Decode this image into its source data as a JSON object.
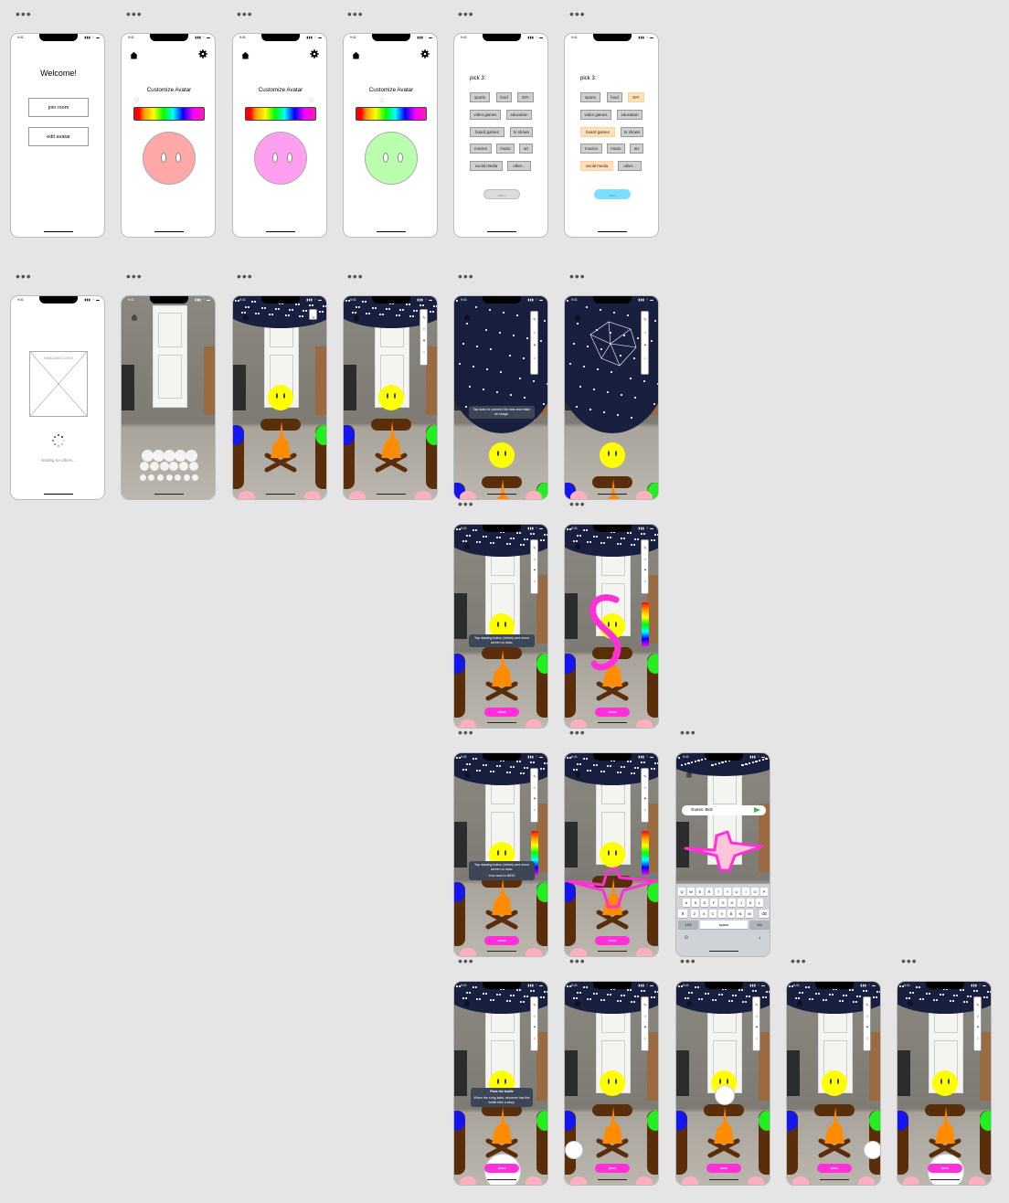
{
  "status": {
    "time": "9:41",
    "icons": "▮▮▮ ⌔ ▬"
  },
  "welcome": {
    "title": "Welcome!",
    "join": "join room",
    "edit": "edit avatar"
  },
  "customize": {
    "title": "Customize Avatar",
    "heart": "♡",
    "colors": [
      "#ffa8a8",
      "#ff9ff0",
      "#baffae"
    ]
  },
  "pick": {
    "title": "pick 3:",
    "chips": [
      "sports",
      "food",
      "DIY",
      "video games",
      "education",
      "board games",
      "tv shows",
      "movies",
      "music",
      "art",
      "social media",
      "other..."
    ],
    "start": "start",
    "selected_count": 3
  },
  "loading": {
    "logo": "KINDLING LOGO",
    "waiting": "Waiting for others..."
  },
  "tips": {
    "stars": "Tap stars to connect the dots and make an image.",
    "draw": "Tap drawing button (below) and move screen to draw.",
    "word": "Your word is BIRD",
    "pass_title": "Pass the bottle",
    "pass_body": "When the song lasts, whoever has the bottle tells a story."
  },
  "buttons": {
    "draw": "draw",
    "pass": "pass"
  },
  "guess": {
    "text": "Guess: Bird"
  },
  "keyboard": {
    "row1": [
      "Q",
      "W",
      "E",
      "R",
      "T",
      "Y",
      "U",
      "I",
      "O",
      "P"
    ],
    "row2": [
      "A",
      "S",
      "D",
      "F",
      "G",
      "H",
      "J",
      "K",
      "L"
    ],
    "row3": [
      "Z",
      "X",
      "C",
      "V",
      "B",
      "N",
      "M"
    ],
    "num": "123",
    "space": "space",
    "go": "Go"
  },
  "colors": {
    "sky": "#19203f",
    "fire": "#ff8c00",
    "log": "#5a2e0a",
    "pink": "#ff30d8",
    "yellow": "#ffff00",
    "blue": "#1515ee",
    "green": "#22ee22"
  }
}
